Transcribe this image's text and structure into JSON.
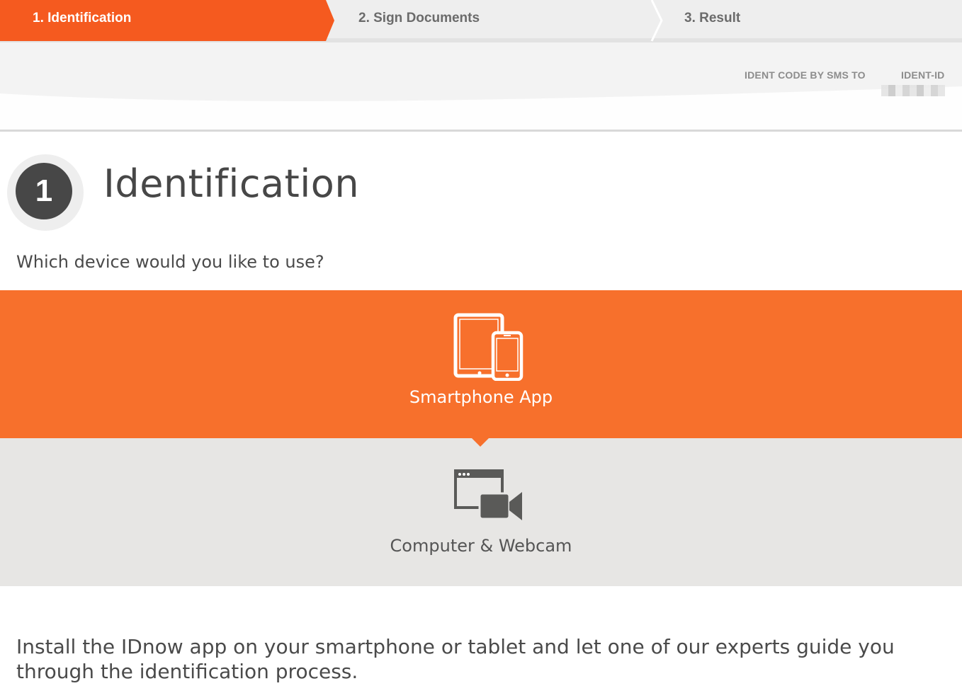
{
  "stepper": {
    "steps": [
      {
        "label": "1. Identification",
        "state": "active"
      },
      {
        "label": "2. Sign Documents",
        "state": "inactive"
      },
      {
        "label": "3. Result",
        "state": "inactive"
      }
    ]
  },
  "header_info": {
    "ident_code_label": "IDENT CODE BY SMS TO",
    "ident_id_label": "IDENT-ID"
  },
  "heading": {
    "step_number": "1",
    "title": "Identification"
  },
  "question": "Which device would you like to use?",
  "options": {
    "smartphone": {
      "label": "Smartphone App",
      "icon": "tablet-smartphone-icon",
      "selected": true
    },
    "webcam": {
      "label": "Computer & Webcam",
      "icon": "computer-webcam-icon",
      "selected": false
    }
  },
  "description": "Install the IDnow app on your smartphone or tablet and let one of our experts guide you through the identification process.",
  "colors": {
    "accent": "#f7702c",
    "step_active": "#f55a1f",
    "dark": "#474747",
    "option_inactive_bg": "#e7e6e4"
  }
}
